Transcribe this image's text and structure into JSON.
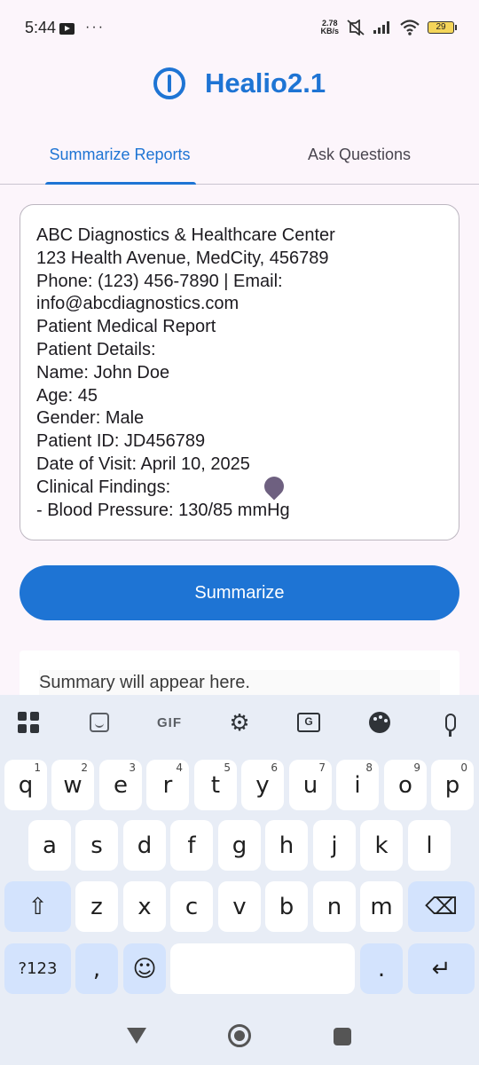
{
  "status_bar": {
    "time": "5:44",
    "more": "···",
    "speed_value": "2.78",
    "speed_unit": "KB/s",
    "battery": "29"
  },
  "app": {
    "title": "Healio2.1",
    "accent_color": "#1e74d4"
  },
  "tabs": [
    {
      "label": "Summarize Reports",
      "active": true
    },
    {
      "label": "Ask Questions",
      "active": false
    }
  ],
  "report": {
    "lines": [
      "ABC Diagnostics & Healthcare Center",
      "123 Health Avenue, MedCity, 456789",
      "Phone: (123) 456-7890 | Email:",
      "info@abcdiagnostics.com",
      "Patient Medical Report",
      "Patient Details:",
      "Name: John Doe",
      "Age: 45",
      "Gender: Male",
      "Patient ID: JD456789",
      "Date of Visit: April 10, 2025",
      "Clinical Findings:",
      "- Blood Pressure: 130/85 mmHg"
    ]
  },
  "summarize_button": "Summarize",
  "summary_placeholder": "Summary will appear here.",
  "keyboard": {
    "toolbar": {
      "gif_label": "GIF",
      "translate_label": "G",
      "icons": [
        "apps-grid-icon",
        "sticker-icon",
        "gif-icon",
        "settings-gear-icon",
        "translate-icon",
        "palette-icon",
        "microphone-icon"
      ]
    },
    "row1": [
      {
        "key": "q",
        "hint": "1"
      },
      {
        "key": "w",
        "hint": "2"
      },
      {
        "key": "e",
        "hint": "3"
      },
      {
        "key": "r",
        "hint": "4"
      },
      {
        "key": "t",
        "hint": "5"
      },
      {
        "key": "y",
        "hint": "6"
      },
      {
        "key": "u",
        "hint": "7"
      },
      {
        "key": "i",
        "hint": "8"
      },
      {
        "key": "o",
        "hint": "9"
      },
      {
        "key": "p",
        "hint": "0"
      }
    ],
    "row2": [
      "a",
      "s",
      "d",
      "f",
      "g",
      "h",
      "j",
      "k",
      "l"
    ],
    "row3": [
      "z",
      "x",
      "c",
      "v",
      "b",
      "n",
      "m"
    ],
    "symbols_label": "?123",
    "comma": ",",
    "period": ".",
    "shift_glyph": "⇧",
    "backspace_glyph": "⌫",
    "enter_glyph": "↵",
    "emoji_glyph": "☺"
  }
}
